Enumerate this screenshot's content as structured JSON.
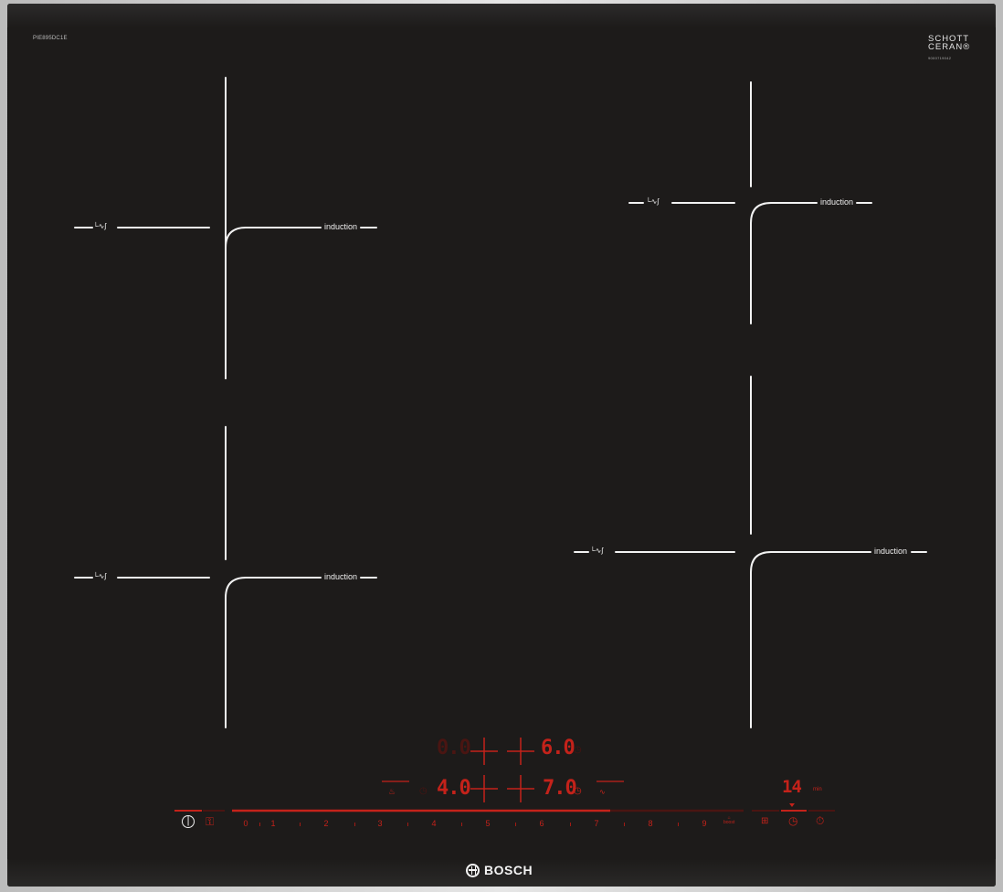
{
  "hob": {
    "model": "PIE895DC1E",
    "glass_brand": [
      "SCHOTT",
      "CERAN®"
    ],
    "glass_small_code": "9000719042",
    "brand": "BOSCH",
    "colors": {
      "glass": "#1d1b1a",
      "lines": "#f2f2f2",
      "display": "#c4221a"
    }
  },
  "zones": [
    {
      "label": "induction",
      "pot_icon": "└∿ʃ"
    },
    {
      "label": "induction",
      "pot_icon": "└∿ʃ"
    },
    {
      "label": "induction",
      "pot_icon": "└∿ʃ"
    },
    {
      "label": "induction",
      "pot_icon": "└∿ʃ"
    }
  ],
  "display": {
    "zone_rear_left": "0.0",
    "zone_rear_right": "6.0",
    "zone_front_left": "4.0",
    "zone_front_right": "7.0",
    "timer": "14",
    "timer_unit": "min"
  },
  "controls": {
    "power_icon": "power-icon",
    "childlock_icon": "childlock-icon",
    "slider_values": [
      "0",
      "1",
      "2",
      "3",
      "4",
      "5",
      "6",
      "7",
      "8",
      "9"
    ],
    "boost_label": "boost",
    "slider_level": 0.7
  }
}
